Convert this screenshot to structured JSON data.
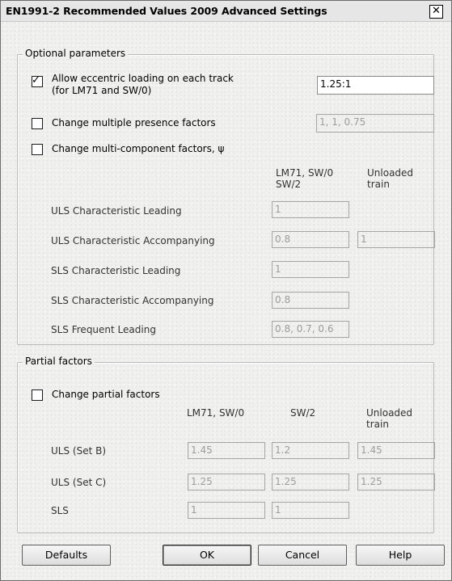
{
  "window": {
    "title": "EN1991-2 Recommended Values 2009 Advanced Settings",
    "close_glyph": "✕"
  },
  "optional": {
    "legend": "Optional parameters",
    "eccentric_line1": "Allow eccentric loading on each track",
    "eccentric_line2": "(for LM71 and SW/0)",
    "eccentric_checked": true,
    "eccentric_value": "1.25:1",
    "presence_label": "Change multiple presence factors",
    "presence_checked": false,
    "presence_value": "1, 1, 0.75",
    "psi_label": "Change multi-component factors, ψ",
    "psi_checked": false,
    "col_lm71_line1": "LM71,  SW/0",
    "col_lm71_line2": "SW/2",
    "col_unloaded_line1": "Unloaded",
    "col_unloaded_line2": "train",
    "rows": [
      {
        "label": "ULS Characteristic Leading",
        "lm71": "1",
        "unloaded": null
      },
      {
        "label": "ULS Characteristic Accompanying",
        "lm71": "0.8",
        "unloaded": "1"
      },
      {
        "label": "SLS Characteristic Leading",
        "lm71": "1",
        "unloaded": null
      },
      {
        "label": "SLS Characteristic Accompanying",
        "lm71": "0.8",
        "unloaded": null
      },
      {
        "label": "SLS Frequent Leading",
        "lm71": "0.8, 0.7, 0.6",
        "unloaded": null
      }
    ]
  },
  "partial": {
    "legend": "Partial factors",
    "change_label": "Change partial factors",
    "change_checked": false,
    "col_lm71": "LM71,  SW/0",
    "col_sw2": "SW/2",
    "col_unloaded_line1": "Unloaded",
    "col_unloaded_line2": "train",
    "rows": [
      {
        "label": "ULS (Set B)",
        "lm71": "1.45",
        "sw2": "1.2",
        "unloaded": "1.45"
      },
      {
        "label": "ULS (Set C)",
        "lm71": "1.25",
        "sw2": "1.25",
        "unloaded": "1.25"
      },
      {
        "label": "SLS",
        "lm71": "1",
        "sw2": "1",
        "unloaded": null
      }
    ]
  },
  "buttons": {
    "defaults": "Defaults",
    "ok": "OK",
    "cancel": "Cancel",
    "help": "Help"
  }
}
